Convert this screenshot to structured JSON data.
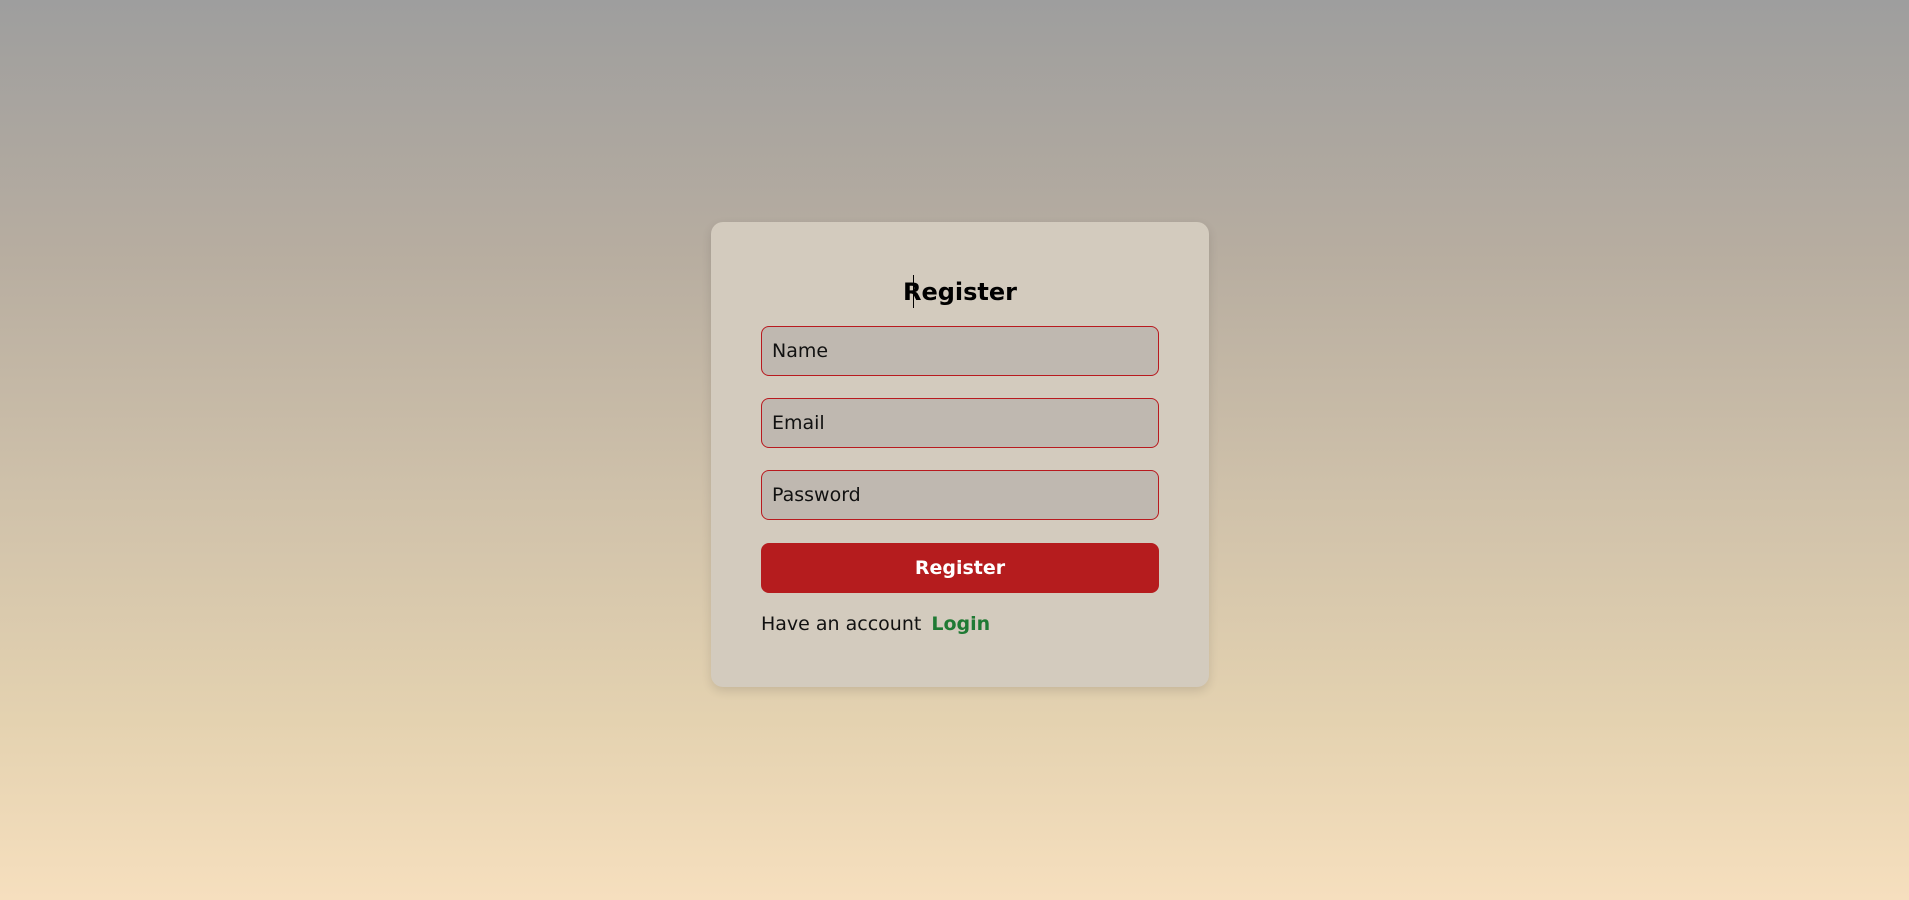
{
  "register_form": {
    "title": "Register",
    "fields": {
      "name": {
        "placeholder": "Name",
        "value": ""
      },
      "email": {
        "placeholder": "Email",
        "value": ""
      },
      "password": {
        "placeholder": "Password",
        "value": ""
      }
    },
    "submit_label": "Register",
    "footer_text": "Have an account",
    "login_link_label": "Login"
  },
  "colors": {
    "accent_red": "#b51c1e",
    "field_border": "#b81a1f",
    "link_green": "#1f7a34",
    "card_background": "#d3cbbe"
  }
}
